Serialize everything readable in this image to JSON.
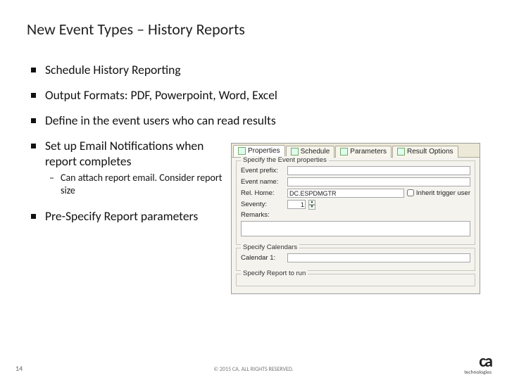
{
  "slide": {
    "title": "New Event Types – History Reports",
    "bullets": {
      "b1": "Schedule History Reporting",
      "b2": "Output Formats: PDF, Powerpoint, Word, Excel",
      "b3": "Define in the event users who can read results",
      "b4": "Set up Email Notifications when report completes",
      "b4_sub": "Can attach report email. Consider report size",
      "b5": "Pre-Specify Report parameters"
    },
    "page_number": "14",
    "copyright": "© 2015 CA. ALL RIGHTS RESERVED.",
    "logo_text": "ca",
    "logo_tag": "technologies"
  },
  "dialog": {
    "tabs": {
      "t1": "Properties",
      "t2": "Schedule",
      "t3": "Parameters",
      "t4": "Result Options"
    },
    "group1_legend": "Specify the Event properties",
    "labels": {
      "event_prefix": "Event prefix:",
      "event_name": "Event name:",
      "rel_home": "Rel. Home:",
      "seventy": "Seventy:",
      "remarks": "Remarks:"
    },
    "values": {
      "rel_home": "DC.ESPDMGTR",
      "seventy": "1"
    },
    "inherit": "Inherit trigger user",
    "group2_legend": "Specify Calendars",
    "calendar1": "Calendar 1:",
    "group3_legend": "Specify Report to run"
  }
}
